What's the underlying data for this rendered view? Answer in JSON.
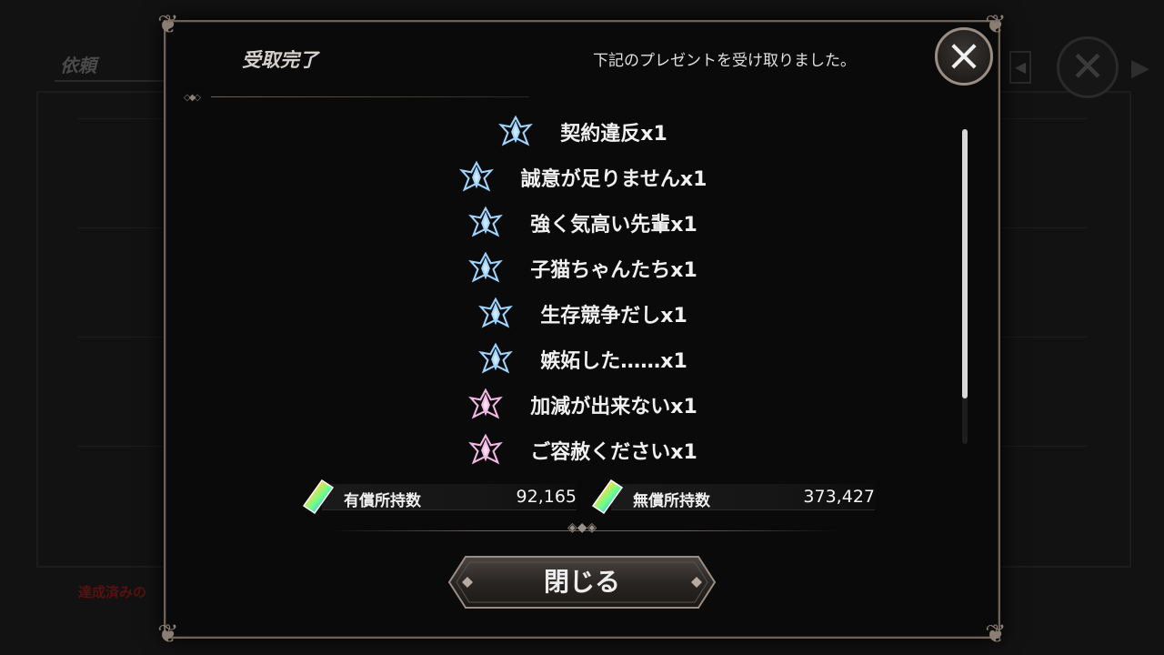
{
  "background": {
    "screen_title": "依頼",
    "footer_notice": "達成済みの",
    "ghost_rows": [
      "",
      "",
      "",
      "",
      ""
    ]
  },
  "dialog": {
    "title": "受取完了",
    "subtitle": "下記のプレゼントを受け取りました。",
    "close_icon": "close-x-icon",
    "items": [
      {
        "label": "契約違反x1",
        "gem": "blue"
      },
      {
        "label": "誠意が足りませんx1",
        "gem": "blue"
      },
      {
        "label": "強く気高い先輩x1",
        "gem": "blue"
      },
      {
        "label": "子猫ちゃんたちx1",
        "gem": "blue"
      },
      {
        "label": "生存競争だしx1",
        "gem": "blue"
      },
      {
        "label": "嫉妬した……x1",
        "gem": "blue"
      },
      {
        "label": "加減が出来ないx1",
        "gem": "pink"
      },
      {
        "label": "ご容赦くださいx1",
        "gem": "pink"
      }
    ],
    "holdings": {
      "paid_label": "有償所持数",
      "paid_value": "92,165",
      "free_label": "無償所持数",
      "free_value": "373,427"
    },
    "close_button_label": "閉じる"
  },
  "colors": {
    "gem_blue": "#9fd4ff",
    "gem_pink": "#f2b8e4",
    "frame": "#6e6258"
  }
}
